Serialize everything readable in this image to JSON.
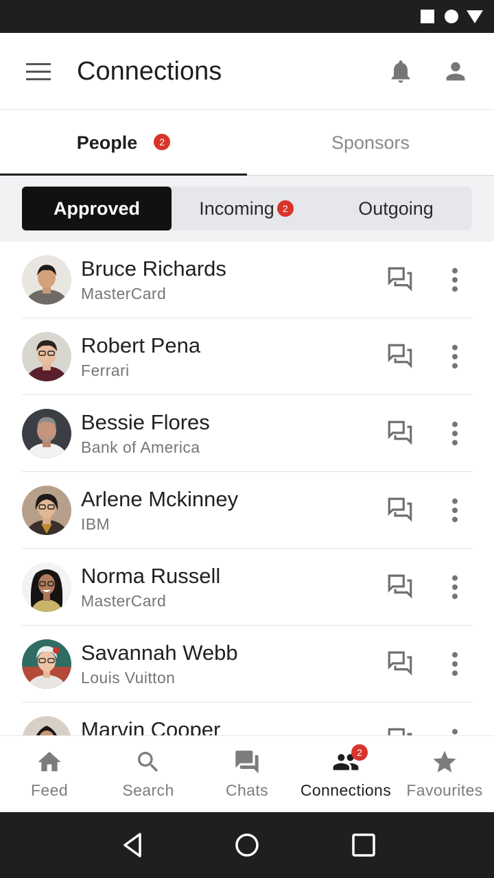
{
  "app_bar": {
    "title": "Connections",
    "menu_icon": "menu-icon",
    "bell_icon": "bell-icon",
    "profile_icon": "account-icon"
  },
  "top_tabs": [
    {
      "label": "People",
      "badge": "2",
      "active": true
    },
    {
      "label": "Sponsors",
      "active": false
    }
  ],
  "segments": [
    {
      "label": "Approved",
      "active": true
    },
    {
      "label": "Incoming",
      "badge": "2",
      "active": false
    },
    {
      "label": "Outgoing",
      "active": false
    }
  ],
  "connections": [
    {
      "name": "Bruce Richards",
      "company": "MasterCard"
    },
    {
      "name": "Robert Pena",
      "company": "Ferrari"
    },
    {
      "name": "Bessie Flores",
      "company": "Bank of America"
    },
    {
      "name": "Arlene Mckinney",
      "company": "IBM"
    },
    {
      "name": "Norma Russell",
      "company": "MasterCard"
    },
    {
      "name": "Savannah Webb",
      "company": "Louis Vuitton"
    },
    {
      "name": "Marvin Cooper",
      "company": ""
    }
  ],
  "row_icons": {
    "chat": "forum-icon",
    "more": "more-vert-icon"
  },
  "bottom_nav": [
    {
      "label": "Feed",
      "icon": "home-icon",
      "active": false
    },
    {
      "label": "Search",
      "icon": "search-icon",
      "active": false
    },
    {
      "label": "Chats",
      "icon": "forum-icon",
      "active": false
    },
    {
      "label": "Connections",
      "icon": "people-icon",
      "active": true,
      "badge": "2"
    },
    {
      "label": "Favourites",
      "icon": "star-icon",
      "active": false
    }
  ],
  "colors": {
    "badge": "#d9342b",
    "active_text": "#1e1e1e",
    "inactive_text": "#7c7c7c",
    "segment_active_bg": "#111111",
    "system_bar": "#1f1f1f"
  }
}
